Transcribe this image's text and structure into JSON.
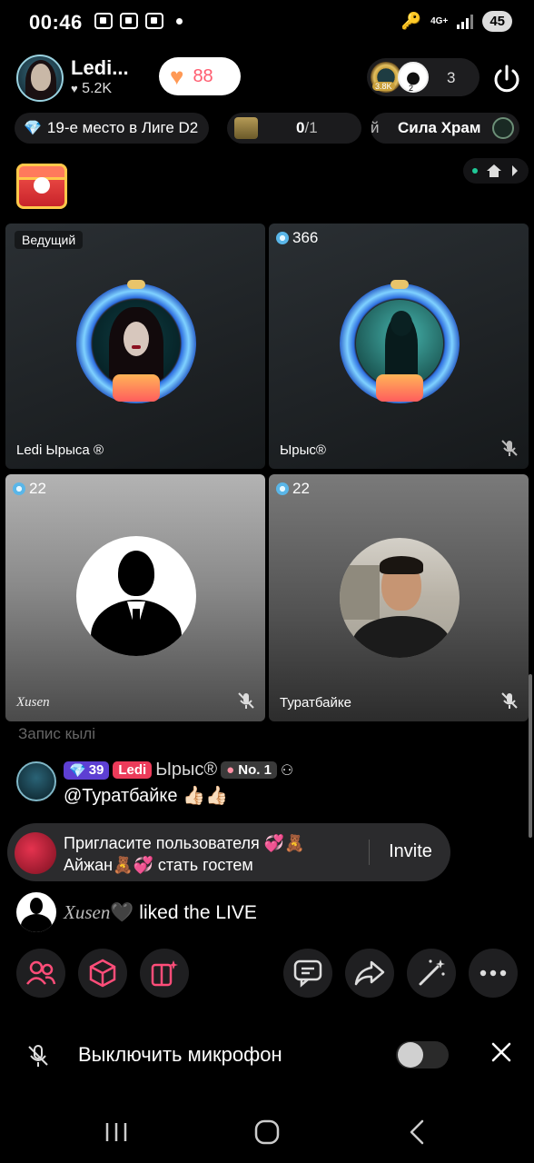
{
  "status_bar": {
    "time": "00:46",
    "network": "4G+",
    "battery": "45"
  },
  "host": {
    "name": "Ledi...",
    "likes": "5.2K",
    "like_pill_count": "88"
  },
  "viewers": {
    "badge1": "3.8K",
    "badge2": "2",
    "count": "3"
  },
  "info_row": {
    "league": "19-е место в Лиге D2",
    "quest_done": "0",
    "quest_total": "/1",
    "power_lead": "й",
    "power_label": "Сила Храм"
  },
  "grid": {
    "cells": [
      {
        "tag": "Ведущий",
        "name": "Ledi Ырыса ®"
      },
      {
        "score": "366",
        "name": "Ырыс®"
      },
      {
        "score": "22",
        "name": "Xusen"
      },
      {
        "score": "22",
        "name": "Туратбайке"
      }
    ]
  },
  "chat": {
    "faded_line": "Запис кылі",
    "message": {
      "level": "39",
      "fan_badge": "Ledi",
      "user": "Ырыс®",
      "rank_badge": "No. 1",
      "text": "@Туратбайке 👍🏻👍🏻"
    },
    "invite": {
      "text": "Пригласите пользователя 💞🧸 Айжан🧸💞 стать гостем",
      "button": "Invite"
    },
    "liked": {
      "user": "Xusen",
      "suffix": "🖤 liked the LIVE"
    }
  },
  "toolbar": {
    "icons": [
      "guests-icon",
      "cube-gift-icon",
      "book-sparkle-icon",
      "chat-bubble-icon",
      "share-icon",
      "magic-wand-icon",
      "more-icon"
    ]
  },
  "mic_bar": {
    "label": "Выключить микрофон"
  },
  "colors": {
    "accent_red": "#ec3b5a",
    "accent_purple": "#5d3fd3",
    "like_heart": "#ff9955",
    "background": "#000000"
  }
}
